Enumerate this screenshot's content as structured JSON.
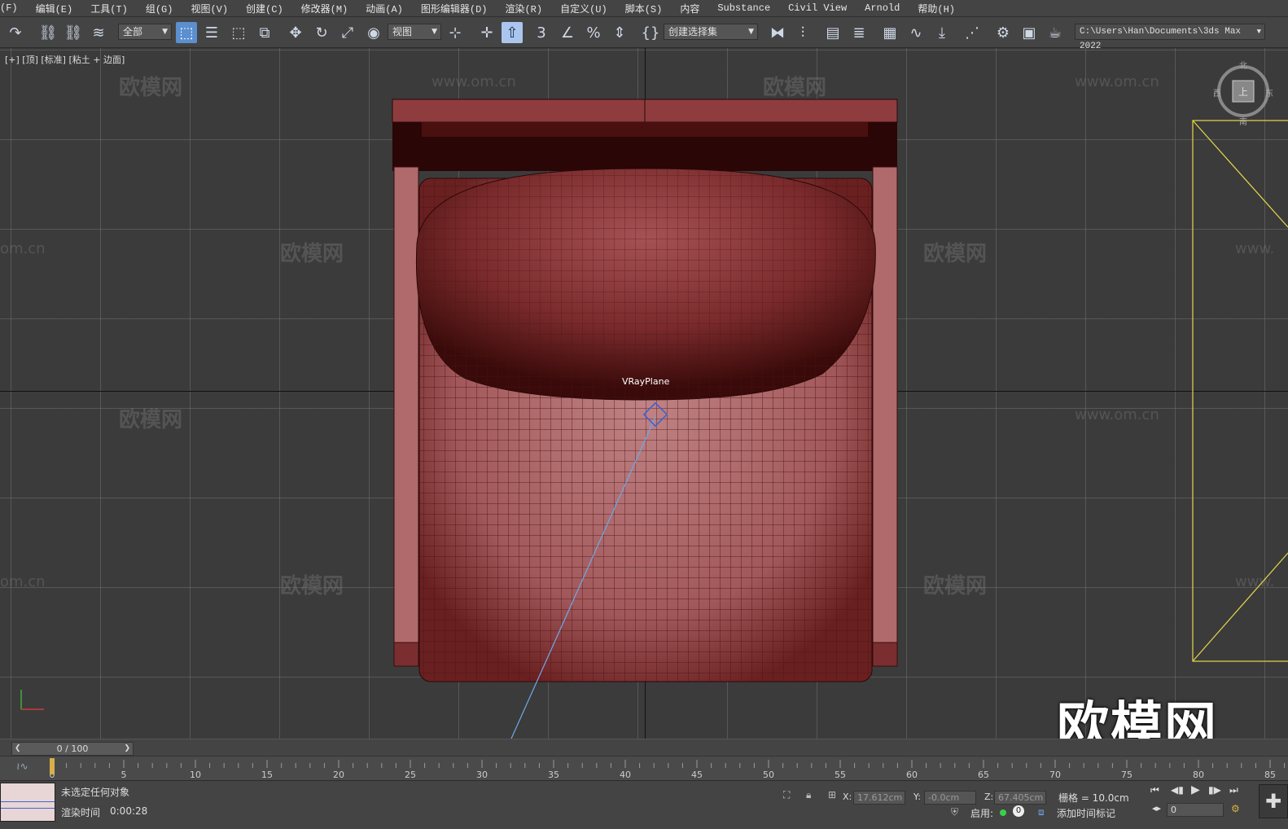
{
  "menubar": {
    "items": [
      "(F)",
      "编辑(E)",
      "工具(T)",
      "组(G)",
      "视图(V)",
      "创建(C)",
      "修改器(M)",
      "动画(A)",
      "图形编辑器(D)",
      "渲染(R)",
      "自定义(U)",
      "脚本(S)",
      "内容",
      "Substance",
      "Civil View",
      "Arnold",
      "帮助(H)"
    ]
  },
  "toolbar": {
    "selection_filter": "全部",
    "ref_coord": "视图",
    "named_selection": "创建选择集",
    "project_path": "C:\\Users\\Han\\Documents\\3ds Max 2022"
  },
  "viewport": {
    "label": "[+] [顶] [标准] [粘土 + 边面]",
    "object_label": "VRayPlane",
    "viewcube": {
      "north": "北",
      "south": "南",
      "east": "东",
      "west": "西",
      "face": "上"
    },
    "watermark_text": "欧模网",
    "watermark_url": "www.om.cn",
    "watermark_url_partial": "om.cn",
    "watermark_url_cut": "www.",
    "big_watermark": "欧模网"
  },
  "timeline": {
    "frame_display": "0 / 100",
    "ticks": [
      "0",
      "5",
      "10",
      "15",
      "20",
      "25",
      "30",
      "35",
      "40",
      "45",
      "50",
      "55",
      "60",
      "65",
      "70",
      "75",
      "80",
      "85"
    ]
  },
  "status": {
    "selection": "未选定任何对象",
    "render_time_label": "渲染时间",
    "render_time": "0:00:28",
    "x_label": "X:",
    "x_value": "17.612cm",
    "y_label": "Y:",
    "y_value": "-0.0cm",
    "z_label": "Z:",
    "z_value": "67.405cm",
    "grid": "栅格 = 10.0cm",
    "enable_label": "启用:",
    "enable_count": "0",
    "add_time_tag": "添加时间标记",
    "frame_field": "0"
  },
  "colors": {
    "model": "#9e4d4f",
    "model_dark": "#2a0808",
    "wire": "#3a0d0d",
    "light_line": "#6fa8e8",
    "selection_rect": "#e6d84a"
  }
}
